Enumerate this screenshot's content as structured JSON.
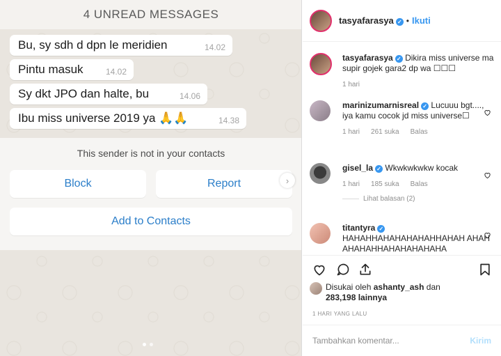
{
  "chat": {
    "unread_banner": "4 UNREAD MESSAGES",
    "messages": [
      {
        "text": "Bu, sy sdh d dpn le meridien",
        "time": "14.02"
      },
      {
        "text": "Pintu masuk",
        "time": "14.02"
      },
      {
        "text": "Sy dkt JPO dan halte, bu",
        "time": "14.06"
      },
      {
        "text": "Ibu miss universe 2019 ya 🙏🙏",
        "time": "14.38"
      }
    ],
    "sender_notice": "This sender is not in your contacts",
    "block_label": "Block",
    "report_label": "Report",
    "add_contacts_label": "Add to Contacts",
    "next_arrow": "›"
  },
  "post": {
    "header": {
      "username": "tasyafarasya",
      "verified_mark": "✓",
      "separator": "•",
      "follow_label": "Ikuti"
    },
    "caption": {
      "username": "tasyafarasya",
      "verified_mark": "✓",
      "text": "Dikira miss universe ma supir gojek gara2 dp wa ☐☐☐",
      "time": "1 hari"
    },
    "comments": [
      {
        "username": "marinizumarnisreal",
        "verified_mark": "✓",
        "text": "Lucuuu bgt...., iya kamu cocok jd miss universe☐",
        "time": "1 hari",
        "likes": "261 suka",
        "reply_label": "Balas"
      },
      {
        "username": "gisel_la",
        "verified_mark": "✓",
        "text": "Wkwkwkwkw kocak",
        "time": "1 hari",
        "likes": "185 suka",
        "reply_label": "Balas",
        "view_replies": "Lihat balasan (2)"
      },
      {
        "username": "titantyra",
        "verified_mark": "✓",
        "text": "HAHAHHAHAHAHAHAHHAHAH AHAHAHAHAHHAHAHAHAHAHA"
      }
    ],
    "liked_by": {
      "prefix": "Disukai oleh",
      "user": "ashanty_ash",
      "suffix": "dan",
      "count": "283,198 lainnya"
    },
    "time_ago": "1 HARI YANG LALU",
    "comment_placeholder": "Tambahkan komentar...",
    "post_label": "Kirim"
  },
  "colors": {
    "accent": "#3897f0",
    "wa_link": "#2b7ec9",
    "muted": "#8e8e8e"
  },
  "icons": [
    "heart-icon",
    "comment-icon",
    "share-icon",
    "bookmark-icon",
    "verified-icon"
  ]
}
